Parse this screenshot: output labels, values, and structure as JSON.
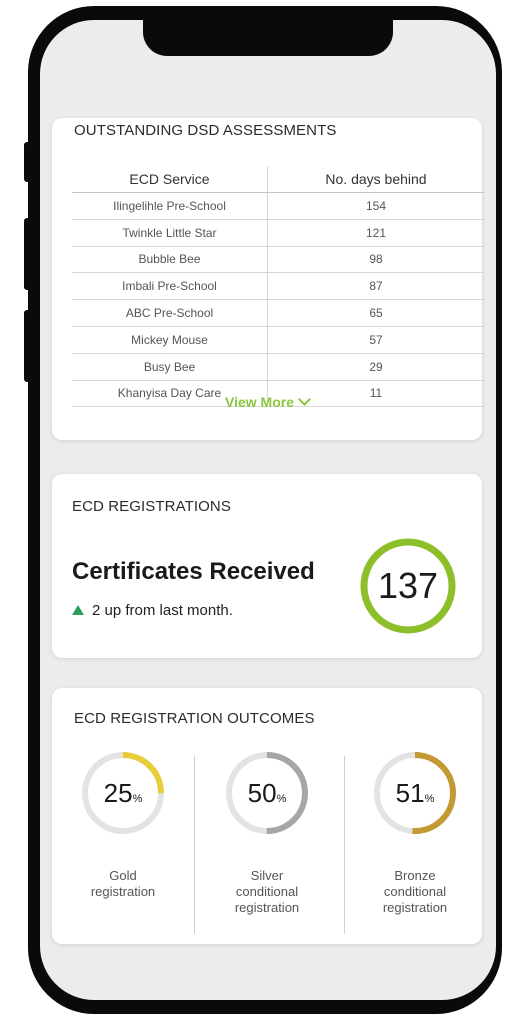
{
  "assessments": {
    "title": "OUTSTANDING DSD ASSESSMENTS",
    "columns": [
      "ECD Service",
      "No. days behind"
    ],
    "rows": [
      {
        "service": "Ilingelihle Pre-School",
        "days": "154"
      },
      {
        "service": "Twinkle Little Star",
        "days": "121"
      },
      {
        "service": "Bubble Bee",
        "days": "98"
      },
      {
        "service": "Imbali Pre-School",
        "days": "87"
      },
      {
        "service": "ABC Pre-School",
        "days": "65"
      },
      {
        "service": "Mickey Mouse",
        "days": "57"
      },
      {
        "service": "Busy Bee",
        "days": "29"
      },
      {
        "service": "Khanyisa Day Care",
        "days": "11"
      }
    ],
    "view_more": "View More"
  },
  "registrations": {
    "title": "ECD REGISTRATIONS",
    "heading": "Certificates Received",
    "trend": "2 up from last month.",
    "count": "137",
    "ring_color": "#8dbf2b"
  },
  "outcomes": {
    "title": "ECD REGISTRATION OUTCOMES",
    "items": [
      {
        "value": "25",
        "unit": "%",
        "fraction": 0.25,
        "label1": "Gold",
        "label2": "registration",
        "label3": "",
        "color": "#e8cd3a"
      },
      {
        "value": "50",
        "unit": "%",
        "fraction": 0.5,
        "label1": "Silver",
        "label2": "conditional",
        "label3": "registration",
        "color": "#a6a6a6"
      },
      {
        "value": "51",
        "unit": "%",
        "fraction": 0.51,
        "label1": "Bronze",
        "label2": "conditional",
        "label3": "registration",
        "color": "#c39a32"
      }
    ]
  },
  "colors": {
    "accent": "#8cc63f",
    "trend_up": "#2e9d5b",
    "track": "#e3e3e3"
  }
}
